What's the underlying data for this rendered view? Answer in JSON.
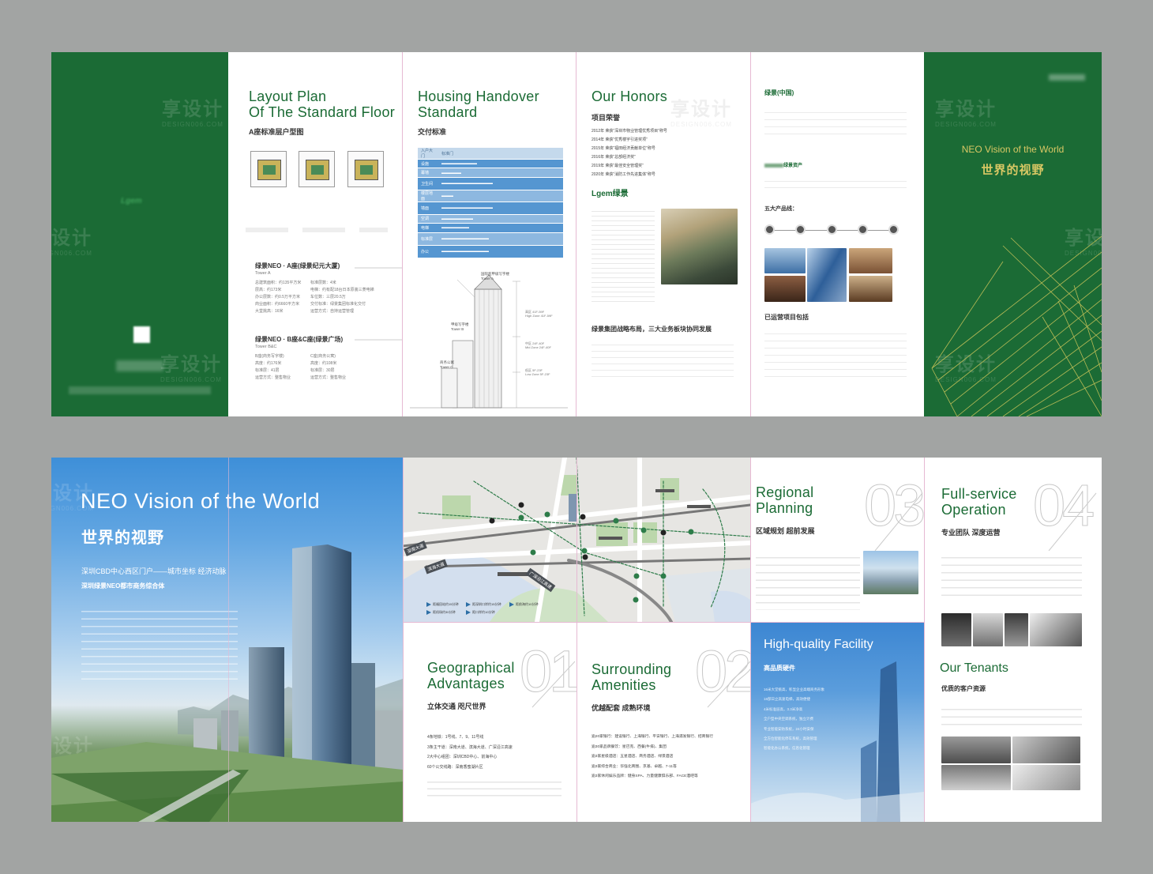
{
  "colors": {
    "green": "#1b6b35",
    "gold": "#d9c864",
    "blue": "#4e90d4",
    "gray_bg": "#a2a4a3",
    "fold": "#e6b9d3"
  },
  "watermark": "享设计",
  "watermark_sub": "DESIGN006.COM",
  "top": {
    "cover_left": {
      "logo_text": "Lgem"
    },
    "layout": {
      "title_line1": "Layout Plan",
      "title_line2": "Of The Standard Floor",
      "subtitle": "A座标准层户型图",
      "towerA": "绿景NEO · A座(绿景纪元大厦)",
      "towerA_en": "Tower A",
      "towerBC": "绿景NEO · B座&C座(绿景广场)",
      "towerBC_en": "Tower B&C",
      "towerA_specs": [
        "总建筑面积：约135平方米",
        "层高：约173米",
        "办公层数：约0.5万平方米",
        "商业面积：约6660平方米",
        "大堂挑高：16米",
        "标准层数：4米",
        "电梯：约有配18台日本原装三菱电梯",
        "车位数：三层20.5万",
        "交付标准：绿景集团标准化交付",
        "运营方式：自持运营管理"
      ],
      "towerBC_specs": [
        "B座(商务写字楼)",
        "高度：约176米",
        "标准层：41层",
        "运营方式：整售物业",
        "C座(商务公寓)",
        "高度：约108米",
        "标准层：30层",
        "运营方式：整售物业"
      ]
    },
    "handover": {
      "title_line1": "Housing Handover",
      "title_line2": "Standard",
      "subtitle": "交付标准",
      "table_header": [
        "入户大门",
        "标准门"
      ],
      "rows": [
        "设施",
        "幕墙",
        "卫生间",
        "楼层地面",
        "墙面",
        "空调",
        "电梯",
        "标准层",
        "办公"
      ],
      "tower_labels": [
        "国际超甲级写字楼",
        "Tower A",
        "甲级写字楼",
        "Tower B",
        "商务公寓",
        "Tower C"
      ],
      "zones": [
        "高区 41F-59F",
        "High Zone 41F-59F",
        "中区 24F-40F",
        "Mid Zone 24F-40F",
        "低区 5F-23F",
        "Low Zone 5F-23F"
      ]
    },
    "honors": {
      "title": "Our Honors",
      "subtitle": "项目荣誉",
      "items": [
        "2012年 荣获“深圳市物业管理优秀项目”称号",
        "2014年 荣获“优秀楼宇引进奖项”",
        "2015年 荣获“福田经济贡献单位”称号",
        "2016年 荣获“总部经济奖”",
        "2019年 荣获“最佳安全管理奖”",
        "2020年 荣获“消防工作先进集体”称号"
      ],
      "logo_text": "Lgem绿景",
      "strategy": "绿景集团战略布局，三大业务板块协同发展"
    },
    "company": {
      "title": "绿景(中国)",
      "asset": "绿景资产",
      "five_lines": "五大产品线：",
      "operated": "已运营项目包括"
    },
    "cover_right": {
      "en": "NEO Vision of the World",
      "cn": "世界的视野"
    }
  },
  "bottom": {
    "hero": {
      "title": "NEO Vision of the World",
      "subtitle": "世界的视野",
      "line1": "深圳CBD中心西区门户——城市坐标 经济动脉",
      "line2": "深圳绿景NEO都市商务综合体"
    },
    "map": {
      "roads": [
        "深南大道",
        "滨海大道",
        "广深沿江高速"
      ],
      "legend": [
        "距福田站约15分钟",
        "距机场约30分钟",
        "距深圳口岸约15分钟",
        "距口岸约10分钟",
        "距前海约10分钟"
      ]
    },
    "geo": {
      "title_line1": "Geographical",
      "title_line2": "Advantages",
      "num": "01",
      "subtitle": "立体交通  咫尺世界",
      "items": [
        "4条地铁：1号线、7、9、11号线",
        "3条主干道：深南大道、滨海大道、广深沿江高速",
        "2大中心组团：深圳CBD中心、前海中心",
        "60个公交线路：深南香蜜湖片区"
      ]
    },
    "amenities": {
      "title_line1": "Surrounding",
      "title_line2": "Amenities",
      "num": "02",
      "subtitle": "优越配套  成熟环境",
      "items": [
        "逾20家银行：建设银行、上海银行、平安银行、上海浦发银行、招商银行",
        "逾30家品牌餐饮：星巴克、西餐(牛排)、集团",
        "逾3家星级酒店：五星酒店、商务酒店、绿景酒店",
        "逾3家综合商业：华强北商圈、京基、卓越、7-11等",
        "逾3家休闲娱乐品牌：健身SPA、力量健康俱乐部、FACE酒吧等"
      ]
    },
    "regional": {
      "title_line1": "Regional",
      "title_line2": "Planning",
      "num": "03",
      "subtitle": "区域规划  超前发展"
    },
    "facility": {
      "title": "High-quality Facility",
      "subtitle": "高品质硬件",
      "items": [
        "16米大堂挑高，彰显企业高端商务形象",
        "18部日立高速电梯，高效便捷",
        "4米标准层高，3.3米净高",
        "全户型中央空调系统，独立计费",
        "专业智能安防系统，24小时安保",
        "全方位智能化停车系统，高效管理",
        "智能化办公系统，信息化管理"
      ]
    },
    "operation": {
      "title_line1": "Full-service",
      "title_line2": "Operation",
      "num": "04",
      "subtitle": "专业团队  深度运营",
      "tenants_title": "Our Tenants",
      "tenants_sub": "优质的客户资源"
    }
  }
}
